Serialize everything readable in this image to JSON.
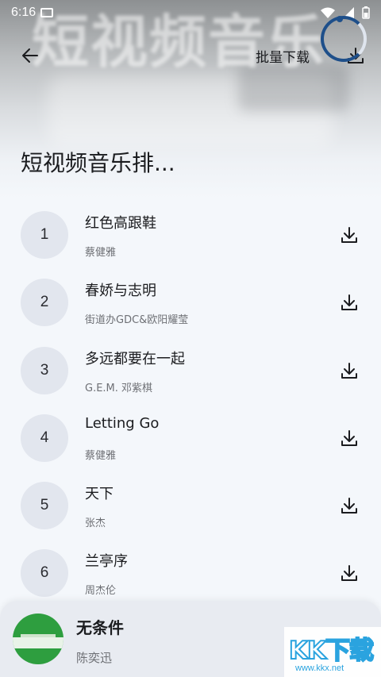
{
  "status_bar": {
    "time": "6:16"
  },
  "header": {
    "banner_text": "短视频音乐",
    "batch_download_label": "批量下载",
    "title": "短视频音乐排..."
  },
  "songs": [
    {
      "rank": "1",
      "title": "红色高跟鞋",
      "artist": "蔡健雅"
    },
    {
      "rank": "2",
      "title": "春娇与志明",
      "artist": "街道办GDC&欧阳耀莹"
    },
    {
      "rank": "3",
      "title": "多远都要在一起",
      "artist": "G.E.M. 邓紫棋"
    },
    {
      "rank": "4",
      "title": "Letting Go",
      "artist": "蔡健雅"
    },
    {
      "rank": "5",
      "title": "天下",
      "artist": "张杰"
    },
    {
      "rank": "6",
      "title": "兰亭序",
      "artist": "周杰伦"
    }
  ],
  "now_playing": {
    "title": "无条件",
    "artist": "陈奕迅"
  },
  "watermark": {
    "logo": "KK下载",
    "url": "www.kkx.net"
  },
  "colors": {
    "accent": "#1e4f8a",
    "background": "#f4f7fb",
    "rank_circle": "#e2e6ee",
    "cover_green": "#2e9e3f"
  },
  "icons": [
    "back-arrow-icon",
    "download-icon",
    "wifi-icon",
    "signal-icon",
    "battery-icon"
  ]
}
